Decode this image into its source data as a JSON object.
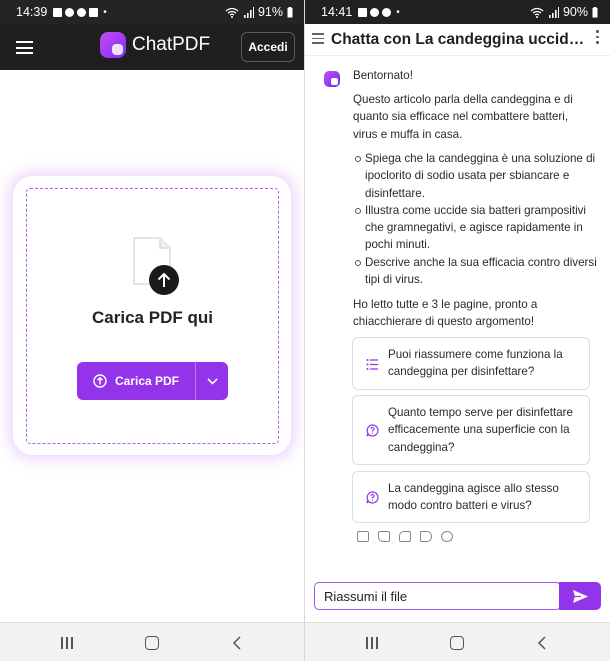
{
  "left": {
    "status": {
      "time": "14:39",
      "battery": "91%"
    },
    "app": {
      "brand": "ChatPDF",
      "login_label": "Accedi"
    },
    "upload": {
      "title": "Carica PDF qui",
      "button_label": "Carica PDF"
    }
  },
  "right": {
    "status": {
      "time": "14:41",
      "battery": "90%"
    },
    "chat": {
      "title": "Chatta con La candeggina uccide batteri, virus e muffa",
      "greeting": "Bentornato!",
      "intro": "Questo articolo parla della candeggina e di quanto sia efficace nel combattere batteri, virus e muffa in casa.",
      "bullets": [
        "Spiega che la candeggina è una soluzione di ipoclorito di sodio usata per sbiancare e disinfettare.",
        "Illustra come uccide sia batteri grampositivi che gramnegativi, e agisce rapidamente in pochi minuti.",
        "Descrive anche la sua efficacia contro diversi tipi di virus."
      ],
      "closing": "Ho letto tutte e 3 le pagine, pronto a chiacchierare di questo argomento!",
      "suggestions": [
        "Puoi riassumere come funziona la candeggina per disinfettare?",
        "Quanto tempo serve per disinfettare efficacemente una superficie con la candeggina?",
        "La candeggina agisce allo stesso modo contro batteri e virus?"
      ],
      "input_value": "Riassumi il file"
    }
  },
  "colors": {
    "accent": "#9333ea",
    "dark_bar": "#1f1f1f"
  }
}
